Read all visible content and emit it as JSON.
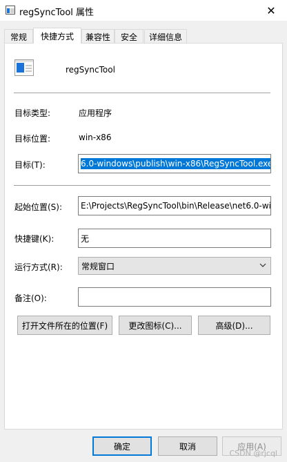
{
  "window": {
    "title": "regSyncTool 属性",
    "close_glyph": "✕"
  },
  "tabs": [
    {
      "label": "常规"
    },
    {
      "label": "快捷方式"
    },
    {
      "label": "兼容性"
    },
    {
      "label": "安全"
    },
    {
      "label": "详细信息"
    }
  ],
  "shortcut": {
    "name": "regSyncTool",
    "target_type_label": "目标类型:",
    "target_type_value": "应用程序",
    "target_location_label": "目标位置:",
    "target_location_value": "win-x86",
    "target_label": "目标(T):",
    "target_value": "6.0-windows\\publish\\win-x86\\RegSyncTool.exe",
    "start_in_label": "起始位置(S):",
    "start_in_value": "E:\\Projects\\RegSyncTool\\bin\\Release\\net6.0-wi",
    "hotkey_label": "快捷键(K):",
    "hotkey_value": "无",
    "run_label": "运行方式(R):",
    "run_value": "常规窗口",
    "comment_label": "备注(O):",
    "comment_value": "",
    "open_location_button": "打开文件所在的位置(F)",
    "change_icon_button": "更改图标(C)...",
    "advanced_button": "高级(D)..."
  },
  "footer": {
    "ok_button": "确定",
    "cancel_button": "取消",
    "apply_button": "应用(A)"
  },
  "watermark": "CSDN @rjcql",
  "colors": {
    "selection": "#0078d7",
    "icon_blue": "#1a73d9"
  }
}
